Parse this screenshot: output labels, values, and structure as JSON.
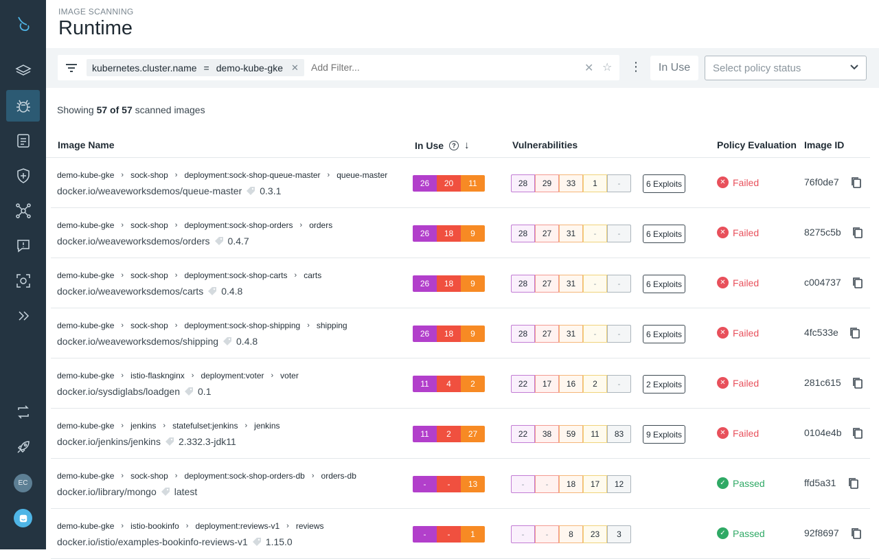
{
  "header": {
    "eyebrow": "IMAGE SCANNING",
    "title": "Runtime"
  },
  "filter": {
    "chip": {
      "key": "kubernetes.cluster.name",
      "op": "=",
      "value": "demo-kube-gke"
    },
    "placeholder": "Add Filter...",
    "in_use_label": "In Use",
    "policy_status_placeholder": "Select policy status"
  },
  "summary": {
    "prefix": "Showing",
    "count": "57 of 57",
    "suffix": "scanned images"
  },
  "table": {
    "columns": {
      "image_name": "Image Name",
      "in_use": "In Use",
      "vulnerabilities": "Vulnerabilities",
      "policy": "Policy Evaluation",
      "image_id": "Image ID"
    },
    "rows": [
      {
        "crumbs": [
          "demo-kube-gke",
          "sock-shop",
          "deployment:sock-shop-queue-master",
          "queue-master"
        ],
        "image": "docker.io/weaveworksdemos/queue-master",
        "tag": "0.3.1",
        "in_use": [
          "26",
          "20",
          "11"
        ],
        "vulns": [
          "28",
          "29",
          "33",
          "1",
          "-"
        ],
        "exploits": "6 Exploits",
        "policy": "Failed",
        "status": "failed",
        "image_id": "76f0de7"
      },
      {
        "crumbs": [
          "demo-kube-gke",
          "sock-shop",
          "deployment:sock-shop-orders",
          "orders"
        ],
        "image": "docker.io/weaveworksdemos/orders",
        "tag": "0.4.7",
        "in_use": [
          "26",
          "18",
          "9"
        ],
        "vulns": [
          "28",
          "27",
          "31",
          "-",
          "-"
        ],
        "exploits": "6 Exploits",
        "policy": "Failed",
        "status": "failed",
        "image_id": "8275c5b"
      },
      {
        "crumbs": [
          "demo-kube-gke",
          "sock-shop",
          "deployment:sock-shop-carts",
          "carts"
        ],
        "image": "docker.io/weaveworksdemos/carts",
        "tag": "0.4.8",
        "in_use": [
          "26",
          "18",
          "9"
        ],
        "vulns": [
          "28",
          "27",
          "31",
          "-",
          "-"
        ],
        "exploits": "6 Exploits",
        "policy": "Failed",
        "status": "failed",
        "image_id": "c004737"
      },
      {
        "crumbs": [
          "demo-kube-gke",
          "sock-shop",
          "deployment:sock-shop-shipping",
          "shipping"
        ],
        "image": "docker.io/weaveworksdemos/shipping",
        "tag": "0.4.8",
        "in_use": [
          "26",
          "18",
          "9"
        ],
        "vulns": [
          "28",
          "27",
          "31",
          "-",
          "-"
        ],
        "exploits": "6 Exploits",
        "policy": "Failed",
        "status": "failed",
        "image_id": "4fc533e"
      },
      {
        "crumbs": [
          "demo-kube-gke",
          "istio-flasknginx",
          "deployment:voter",
          "voter"
        ],
        "image": "docker.io/sysdiglabs/loadgen",
        "tag": "0.1",
        "in_use": [
          "11",
          "4",
          "2"
        ],
        "vulns": [
          "22",
          "17",
          "16",
          "2",
          "-"
        ],
        "exploits": "2 Exploits",
        "policy": "Failed",
        "status": "failed",
        "image_id": "281c615"
      },
      {
        "crumbs": [
          "demo-kube-gke",
          "jenkins",
          "statefulset:jenkins",
          "jenkins"
        ],
        "image": "docker.io/jenkins/jenkins",
        "tag": "2.332.3-jdk11",
        "in_use": [
          "11",
          "2",
          "27"
        ],
        "vulns": [
          "22",
          "38",
          "59",
          "11",
          "83"
        ],
        "exploits": "9 Exploits",
        "policy": "Failed",
        "status": "failed",
        "image_id": "0104e4b"
      },
      {
        "crumbs": [
          "demo-kube-gke",
          "sock-shop",
          "deployment:sock-shop-orders-db",
          "orders-db"
        ],
        "image": "docker.io/library/mongo",
        "tag": "latest",
        "in_use": [
          "-",
          "-",
          "13"
        ],
        "vulns": [
          "-",
          "-",
          "18",
          "17",
          "12"
        ],
        "exploits": "",
        "policy": "Passed",
        "status": "passed",
        "image_id": "ffd5a31"
      },
      {
        "crumbs": [
          "demo-kube-gke",
          "istio-bookinfo",
          "deployment:reviews-v1",
          "reviews"
        ],
        "image": "docker.io/istio/examples-bookinfo-reviews-v1",
        "tag": "1.15.0",
        "in_use": [
          "-",
          "-",
          "1"
        ],
        "vulns": [
          "-",
          "-",
          "8",
          "23",
          "3"
        ],
        "exploits": "",
        "policy": "Passed",
        "status": "passed",
        "image_id": "92f8697"
      }
    ]
  },
  "user": {
    "initials": "EC"
  },
  "icons": [
    "logo-icon",
    "layers-icon",
    "bug-icon",
    "report-icon",
    "shield-plus-icon",
    "network-icon",
    "chat-alert-icon",
    "scan-icon",
    "expand-icon",
    "refresh-icon",
    "rocket-icon",
    "help-chat-icon"
  ]
}
